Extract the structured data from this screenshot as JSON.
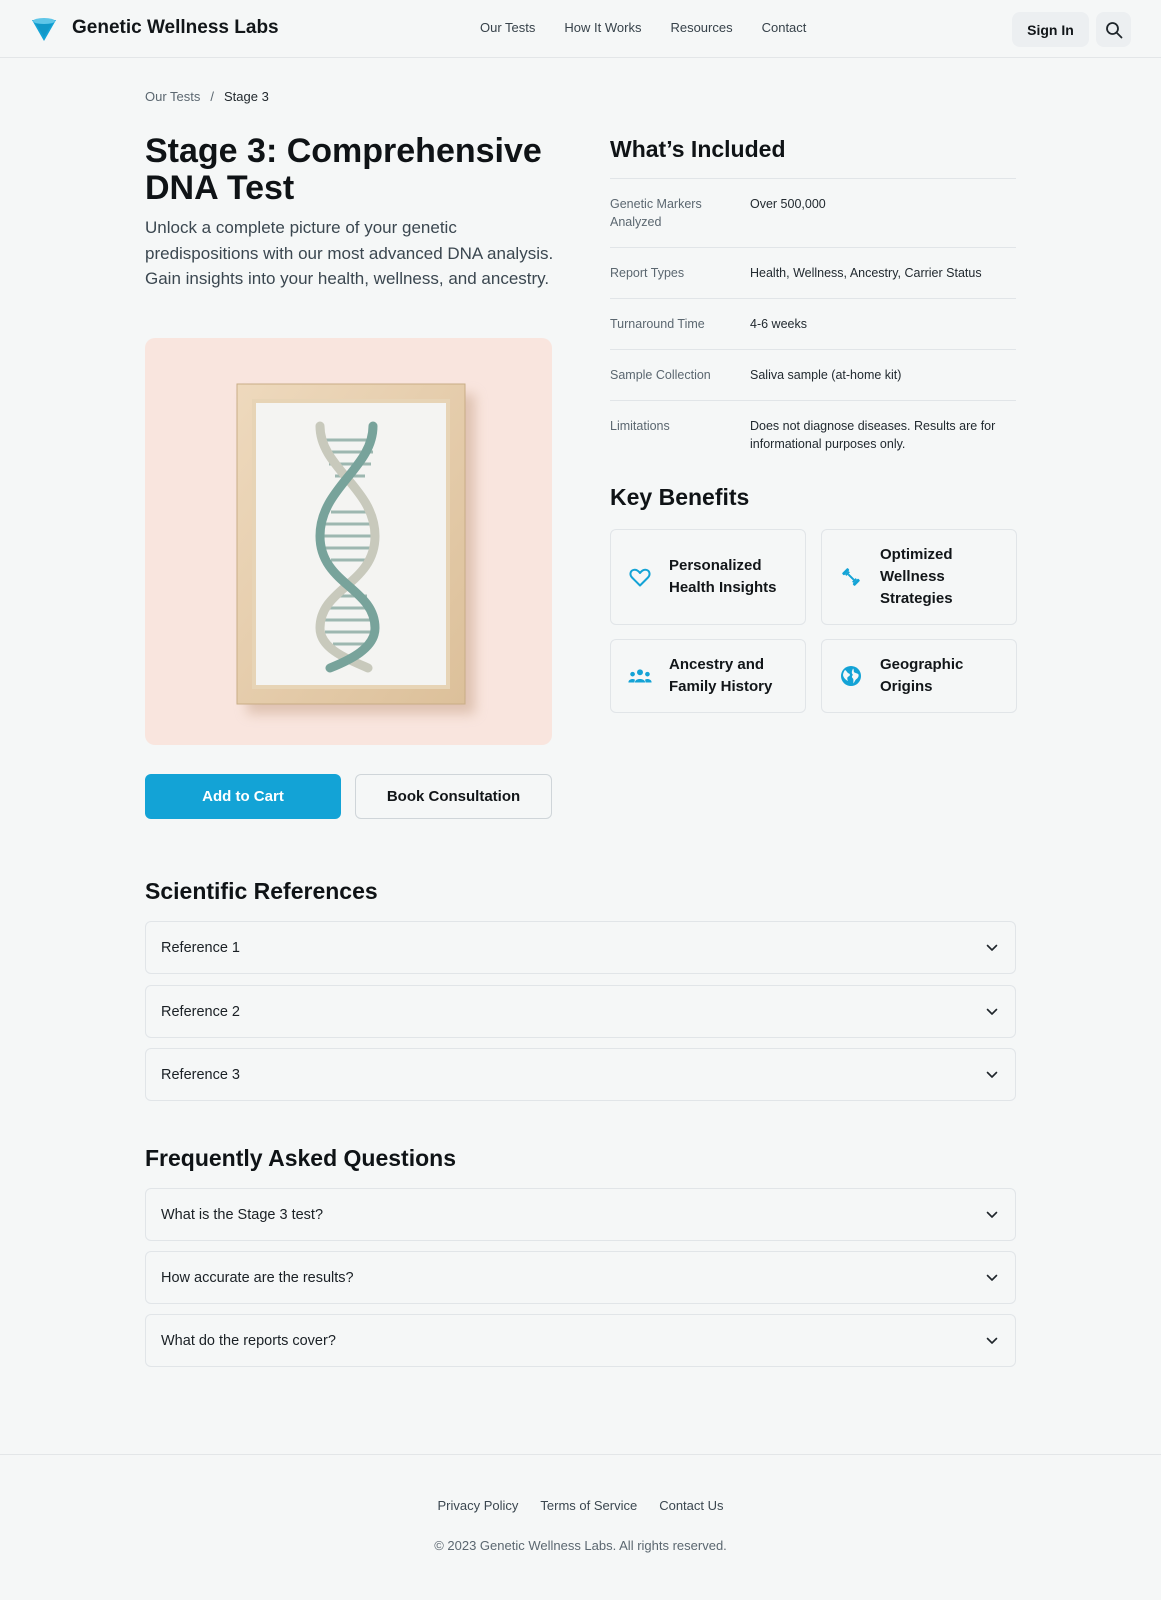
{
  "header": {
    "brand": "Genetic Wellness Labs",
    "nav": [
      "Our Tests",
      "How It Works",
      "Resources",
      "Contact"
    ],
    "sign_in": "Sign In"
  },
  "breadcrumb": {
    "parent": "Our Tests",
    "separator": "/",
    "current": "Stage 3"
  },
  "product": {
    "title": "Stage 3: Comprehensive DNA Test",
    "description": "Unlock a complete picture of your genetic predispositions with our most advanced DNA analysis. Gain insights into your health, wellness, and ancestry.",
    "add_to_cart": "Add to Cart",
    "book_consultation": "Book Consultation"
  },
  "included": {
    "heading": "What’s Included",
    "rows": [
      {
        "label": "Genetic Markers Analyzed",
        "value": "Over 500,000"
      },
      {
        "label": "Report Types",
        "value": "Health, Wellness, Ancestry, Carrier Status"
      },
      {
        "label": "Turnaround Time",
        "value": "4-6 weeks"
      },
      {
        "label": "Sample Collection",
        "value": "Saliva sample (at-home kit)"
      },
      {
        "label": "Limitations",
        "value": "Does not diagnose diseases. Results are for informational purposes only."
      }
    ]
  },
  "benefits": {
    "heading": "Key Benefits",
    "items": [
      {
        "label": "Personalized Health Insights",
        "icon": "heart-icon"
      },
      {
        "label": "Optimized Wellness Strategies",
        "icon": "dumbbell-icon"
      },
      {
        "label": "Ancestry and Family History",
        "icon": "people-icon"
      },
      {
        "label": "Geographic Origins",
        "icon": "globe-icon"
      }
    ]
  },
  "references": {
    "heading": "Scientific References",
    "items": [
      "Reference 1",
      "Reference 2",
      "Reference 3"
    ]
  },
  "faq": {
    "heading": "Frequently Asked Questions",
    "items": [
      "What is the Stage 3 test?",
      "How accurate are the results?",
      "What do the reports cover?"
    ]
  },
  "footer": {
    "links": [
      "Privacy Policy",
      "Terms of Service",
      "Contact Us"
    ],
    "copyright": "© 2023 Genetic Wellness Labs. All rights reserved."
  },
  "colors": {
    "accent": "#13a3d6",
    "background": "#f5f7f7",
    "image_background": "#f9e5de"
  }
}
